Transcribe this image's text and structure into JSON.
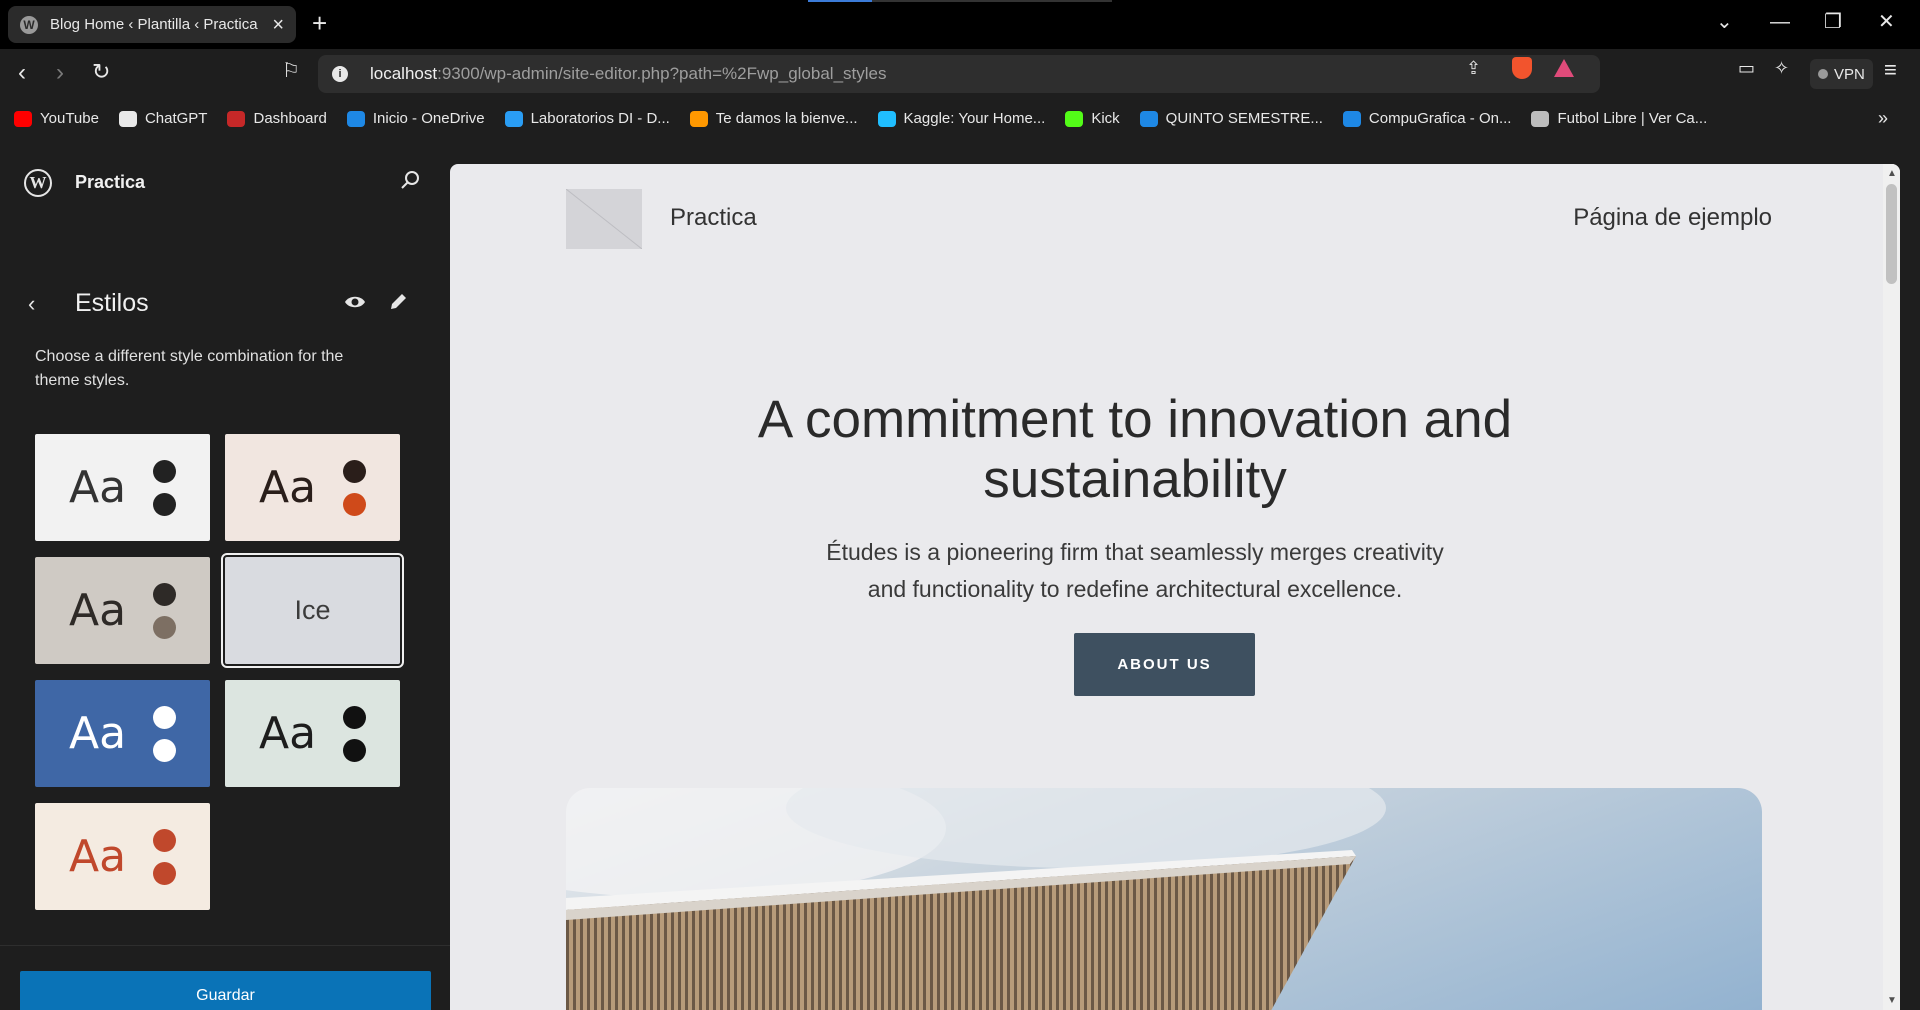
{
  "browser": {
    "tab_title": "Blog Home ‹ Plantilla ‹ Practica",
    "url_host": "localhost",
    "url_rest": ":9300/wp-admin/site-editor.php?path=%2Fwp_global_styles",
    "vpn_label": "VPN",
    "bookmarks": [
      {
        "label": "YouTube",
        "color": "#ff0000"
      },
      {
        "label": "ChatGPT",
        "color": "#e8e8e8"
      },
      {
        "label": "Dashboard",
        "color": "#c62828"
      },
      {
        "label": "Inicio - OneDrive",
        "color": "#1e88e5"
      },
      {
        "label": "Laboratorios DI - D...",
        "color": "#2a9df4"
      },
      {
        "label": "Te damos la bienve...",
        "color": "#ff9800"
      },
      {
        "label": "Kaggle: Your Home...",
        "color": "#20beff"
      },
      {
        "label": "Kick",
        "color": "#53fc18"
      },
      {
        "label": "QUINTO SEMESTRE...",
        "color": "#1e88e5"
      },
      {
        "label": "CompuGrafica - On...",
        "color": "#1e88e5"
      },
      {
        "label": "Futbol Libre | Ver Ca...",
        "color": "#bdbdbd"
      }
    ]
  },
  "sidebar": {
    "site_title": "Practica",
    "panel_title": "Estilos",
    "description": "Choose a different style combination for the theme styles.",
    "save_label": "Guardar",
    "variations": [
      {
        "label": "Aa",
        "bg": "#f2f2f2",
        "text": "#333333",
        "dot1": "#222222",
        "dot2": "#222222"
      },
      {
        "label": "Aa",
        "bg": "#f1e6e0",
        "text": "#2a1e1a",
        "dot1": "#2a1e1a",
        "dot2": "#cf4a1a"
      },
      {
        "label": "Aa",
        "bg": "#cfcac4",
        "text": "#2e2a27",
        "dot1": "#2e2a27",
        "dot2": "#7d6f63"
      },
      {
        "label": "Ice",
        "bg": "#d9dbe0",
        "text": "#3c3c3c",
        "selected": true
      },
      {
        "label": "Aa",
        "bg": "#3f67a6",
        "text": "#ffffff",
        "dot1": "#ffffff",
        "dot2": "#ffffff"
      },
      {
        "label": "Aa",
        "bg": "#dce5e0",
        "text": "#1d1d1d",
        "dot1": "#111111",
        "dot2": "#111111"
      },
      {
        "label": "Aa",
        "bg": "#f4ebe1",
        "text": "#c0482c",
        "dot1": "#c0482c",
        "dot2": "#c0482c"
      }
    ]
  },
  "preview": {
    "site_title": "Practica",
    "nav_link": "Página de ejemplo",
    "hero_title": "A commitment to innovation and sustainability",
    "hero_subtitle": "Études is a pioneering firm that seamlessly merges creativity and functionality to redefine architectural excellence.",
    "hero_button": "ABOUT US"
  }
}
